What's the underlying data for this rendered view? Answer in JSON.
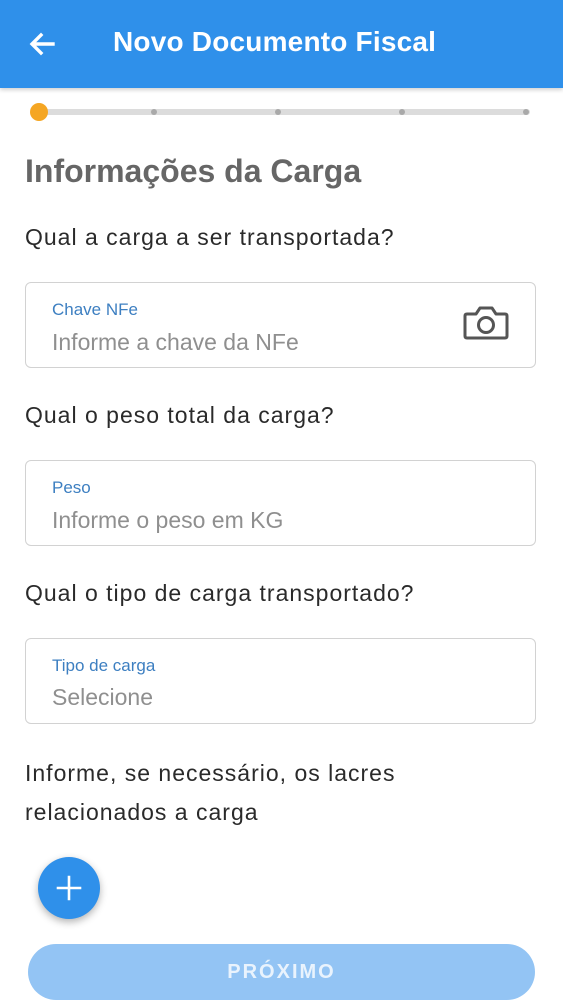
{
  "appbar": {
    "title": "Novo Documento Fiscal",
    "back_icon": "arrow-left-icon",
    "background_color": "#2f90ea"
  },
  "stepper": {
    "total_steps": 5,
    "current_step": 1,
    "active_color": "#f5a623"
  },
  "section": {
    "title": "Informações da Carga"
  },
  "questions": {
    "cargo": "Qual a carga a ser transportada?",
    "weight": "Qual o peso total da carga?",
    "type": "Qual o tipo de carga transportado?",
    "seals_line1": "Informe, se necessário, os lacres",
    "seals_line2": "relacionados a carga"
  },
  "fields": {
    "nfe": {
      "label": "Chave NFe",
      "placeholder": "Informe a chave da NFe",
      "value": "",
      "icon": "camera-icon"
    },
    "weight": {
      "label": "Peso",
      "placeholder": "Informe o peso em KG",
      "value": ""
    },
    "cargo_type": {
      "label": "Tipo de carga",
      "selected": "Selecione"
    }
  },
  "fab": {
    "icon": "plus-icon"
  },
  "footer": {
    "next_label": "PRÓXIMO"
  }
}
